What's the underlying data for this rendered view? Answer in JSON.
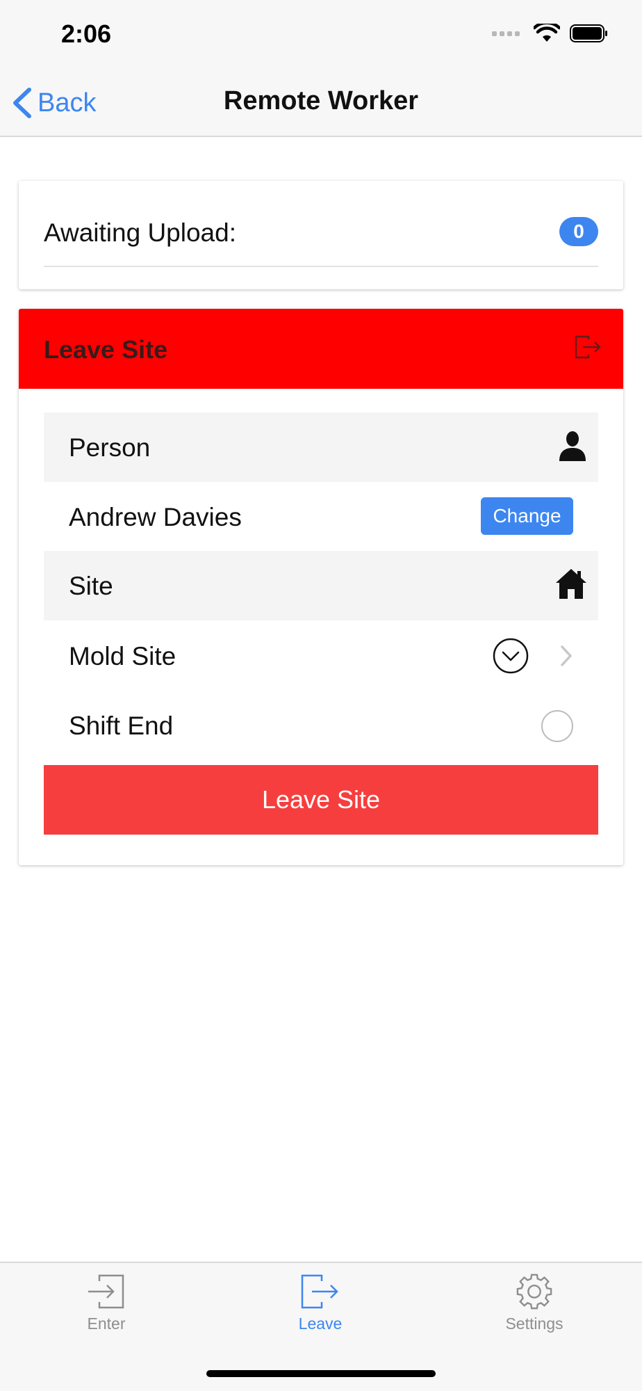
{
  "status_bar": {
    "time": "2:06"
  },
  "nav": {
    "back_label": "Back",
    "title": "Remote Worker"
  },
  "upload": {
    "label": "Awaiting Upload:",
    "count": "0"
  },
  "leave_panel": {
    "header_title": "Leave Site",
    "person_label": "Person",
    "person_name": "Andrew Davies",
    "change_label": "Change",
    "site_label": "Site",
    "site_value": "Mold Site",
    "shift_end_label": "Shift End",
    "shift_end_checked": false,
    "submit_label": "Leave Site"
  },
  "tabs": [
    {
      "label": "Enter",
      "icon": "enter-icon",
      "active": false
    },
    {
      "label": "Leave",
      "icon": "leave-icon",
      "active": true
    },
    {
      "label": "Settings",
      "icon": "gear-icon",
      "active": false
    }
  ],
  "colors": {
    "accent": "#3d86f0",
    "header_red": "#ff0000",
    "button_red": "#f63e3e",
    "bar_bg": "#f7f7f7"
  }
}
